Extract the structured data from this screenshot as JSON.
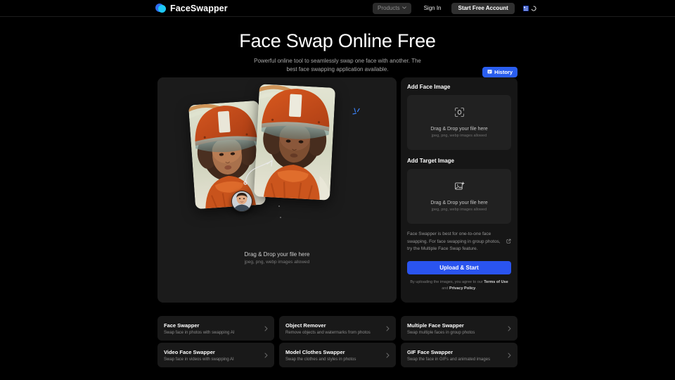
{
  "header": {
    "brand_name": "FaceSwapper",
    "logo_back_color": "#2f6bf0",
    "logo_front_color": "#1ec8f5",
    "products_label": "Products",
    "products_chevron": "chevron-down-icon",
    "signin_label": "Sign In",
    "start_account_label": "Start Free Account",
    "flag_icon": "language-flag-icon",
    "spinner_icon": "loading-spinner-icon"
  },
  "hero": {
    "title": "Face Swap Online Free",
    "subtitle": "Powerful online tool to seamlessly swap one face with another. The best face swapping application available."
  },
  "preview": {
    "drop_main": "Drag & Drop your file here",
    "drop_sub": "jpeg, png, webp images allowed",
    "source_photo": "astronaut-woman-photo",
    "target_photo": "astronaut-man-photo",
    "avatar": "face-avatar-thumbnail",
    "arrow_icon": "swap-curved-arrow-icon",
    "sparkle_icon": "sparkle-icon"
  },
  "controls": {
    "history_label": "History",
    "history_icon": "history-calendar-icon",
    "face_section_label": "Add Face Image",
    "face_dropzone": {
      "icon": "face-scan-icon",
      "main": "Drag & Drop your file here",
      "sub": "jpeg, png, webp images allowed"
    },
    "target_section_label": "Add Target Image",
    "target_dropzone": {
      "icon": "image-add-icon",
      "main": "Drag & Drop your file here",
      "sub": "jpeg, png, webp images allowed"
    },
    "info_text": "Face Swapper is best for one-to-one face swapping. For face swapping in group photos, try the Multiple Face Swap feature.",
    "info_link_icon": "external-link-icon",
    "upload_label": "Upload & Start",
    "legal_prefix": "By uploading the images, you agree to our ",
    "legal_terms": "Terms of Use",
    "legal_and": " and ",
    "legal_privacy": "Privacy Policy",
    "legal_suffix": ".",
    "accent_blue": "#2a54ef",
    "history_blue": "#2a5ef0"
  },
  "cards": [
    {
      "title": "Face Swapper",
      "desc": "Swap face in photos with swapping AI",
      "chevron": "chevron-right-icon"
    },
    {
      "title": "Object Remover",
      "desc": "Remove objects and watermarks from photos",
      "chevron": "chevron-right-icon"
    },
    {
      "title": "Multiple Face Swapper",
      "desc": "Swap multiple faces in group photos",
      "chevron": "chevron-right-icon"
    },
    {
      "title": "Video Face Swapper",
      "desc": "Swap face in videos with swapping AI",
      "chevron": "chevron-right-icon"
    },
    {
      "title": "Model Clothes Swapper",
      "desc": "Swap the clothes and styles in photos",
      "chevron": "chevron-right-icon"
    },
    {
      "title": "GIF Face Swapper",
      "desc": "Swap the face in GIFs and animated images",
      "chevron": "chevron-right-icon"
    }
  ]
}
